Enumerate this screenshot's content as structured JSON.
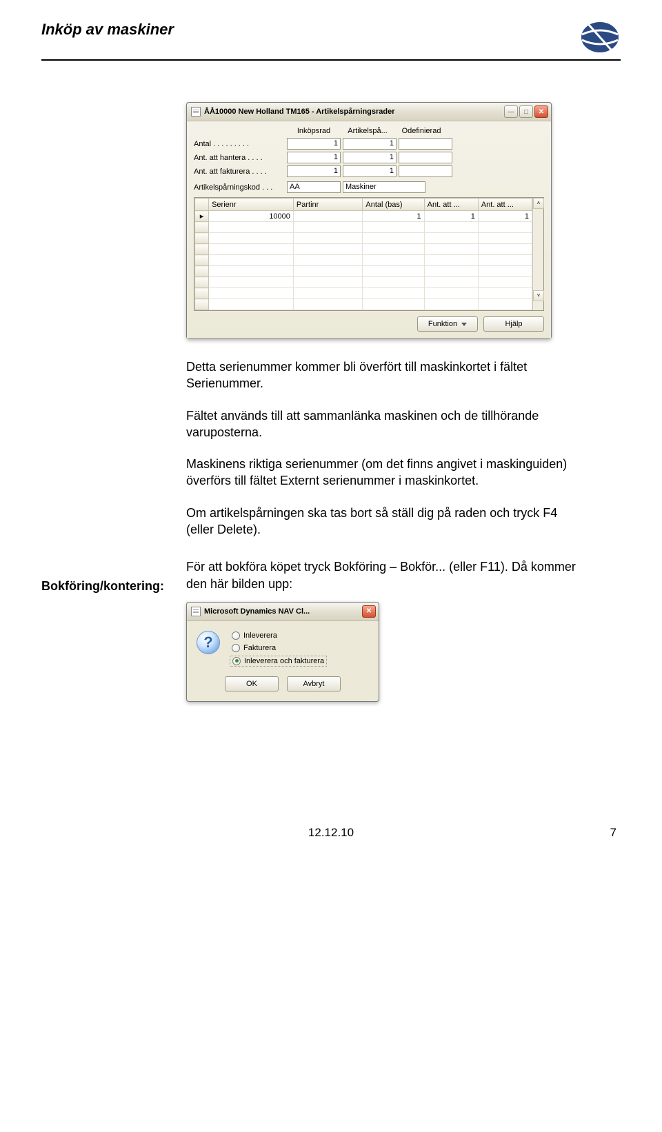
{
  "header": {
    "title": "Inköp av maskiner"
  },
  "win1": {
    "title": "ÅÅ10000 New Holland TM165 - Artikelspårningsrader",
    "cols": {
      "c1": "Inköpsrad",
      "c2": "Artikelspå...",
      "c3": "Odefinierad"
    },
    "rows": {
      "r1": {
        "label": "Antal . . . . . . . . .",
        "v1": "1",
        "v2": "1",
        "v3": ""
      },
      "r2": {
        "label": "Ant. att hantera  . . . .",
        "v1": "1",
        "v2": "1",
        "v3": ""
      },
      "r3": {
        "label": "Ant. att fakturera . . . .",
        "v1": "1",
        "v2": "1",
        "v3": ""
      },
      "r4": {
        "label": "Artikelspårningskod  . . .",
        "v1": "AA",
        "v2": "Maskiner"
      }
    },
    "grid": {
      "h1": "Serienr",
      "h2": "Partinr",
      "h3": "Antal (bas)",
      "h4": "Ant. att ...",
      "h5": "Ant. att ...",
      "cell_serienr": "10000",
      "cell_antal": "1",
      "cell_att1": "1",
      "cell_att2": "1",
      "marker": "▸"
    },
    "buttons": {
      "funktion": "Funktion",
      "hjalp": "Hjälp"
    }
  },
  "paragraphs": {
    "p1": "Detta serienummer kommer bli överfört till maskinkortet i fältet Serienummer.",
    "p2": "Fältet används till att sammanlänka maskinen och de tillhörande varuposterna.",
    "p3": "Maskinens riktiga serienummer (om det finns angivet i maskinguiden) överförs till fältet Externt serienummer i maskinkortet.",
    "p4": "Om artikelspårningen ska tas bort så ställ dig på raden och tryck F4 (eller Delete)."
  },
  "section2": {
    "label": "Bokföring/kontering:",
    "text": "För att bokföra köpet tryck Bokföring – Bokför... (eller F11). Då kommer den här bilden upp:"
  },
  "dlg": {
    "title": "Microsoft Dynamics NAV Cl...",
    "icon": "?",
    "opts": {
      "o1": "Inleverera",
      "o2": "Fakturera",
      "o3": "Inleverera och fakturera"
    },
    "buttons": {
      "ok": "OK",
      "cancel": "Avbryt"
    }
  },
  "footer": {
    "date": "12.12.10",
    "page": "7"
  }
}
